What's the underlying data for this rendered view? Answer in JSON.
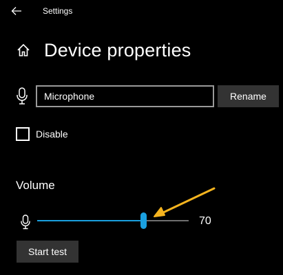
{
  "window": {
    "title": "Settings",
    "back_icon": "back-arrow-icon"
  },
  "header": {
    "icon": "home-icon",
    "title": "Device properties"
  },
  "device": {
    "icon": "microphone-icon",
    "name_value": "Microphone",
    "rename_label": "Rename"
  },
  "disable": {
    "label": "Disable",
    "checked": false
  },
  "volume": {
    "title": "Volume",
    "icon": "microphone-icon",
    "value": 70,
    "value_text": "70",
    "min": 0,
    "max": 100
  },
  "test": {
    "label": "Start test"
  },
  "annotation": {
    "icon": "annotation-arrow",
    "color": "#f5b41f"
  },
  "colors": {
    "background": "#000000",
    "accent": "#1aa0e0",
    "button": "#333333",
    "input_border": "#9a9a9a"
  }
}
